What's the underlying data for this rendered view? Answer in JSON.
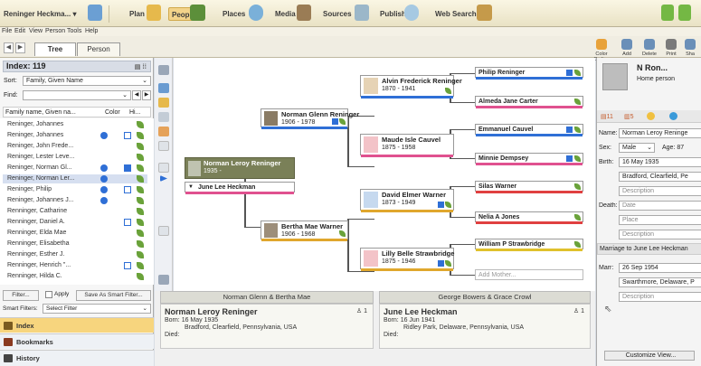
{
  "toolbar": {
    "file_name": "Reninger Heckma... ▾",
    "items": [
      "Plan",
      "People",
      "Places",
      "Media",
      "Sources",
      "Publish",
      "Web Search"
    ],
    "colors": {
      "people_active": "#f3d38a",
      "accent_green": "#6aa23a"
    }
  },
  "menu": [
    "File",
    "Edit",
    "View",
    "Person",
    "Tools",
    "Help"
  ],
  "views": {
    "tabs": [
      "Tree",
      "Person"
    ],
    "active": "Tree"
  },
  "tools": [
    "Color Coding",
    "Add",
    "Delete",
    "Print",
    "Sha"
  ],
  "index": {
    "title": "Index: 119",
    "sort_label": "Sort:",
    "sort_value": "Family, Given Name",
    "find_label": "Find:",
    "columns": [
      "Family name, Given na...",
      "Color",
      "Hi..."
    ],
    "rows": [
      {
        "name": "Reninger, Johannes",
        "dot": false,
        "sq": "none"
      },
      {
        "name": "Reninger, Johannes",
        "dot": true,
        "sq": "empty"
      },
      {
        "name": "Reninger, John Frede...",
        "dot": false,
        "sq": "none"
      },
      {
        "name": "Reninger, Lester Leve...",
        "dot": false,
        "sq": "none"
      },
      {
        "name": "Reninger, Norman Gl...",
        "dot": true,
        "sq": "filled"
      },
      {
        "name": "Reninger, Norman Ler...",
        "dot": true,
        "sq": "none",
        "selected": true
      },
      {
        "name": "Reninger, Philip",
        "dot": true,
        "sq": "empty"
      },
      {
        "name": "Reninger, Johannes J...",
        "dot": true,
        "sq": "none"
      },
      {
        "name": "Renninger, Catharine",
        "dot": false,
        "sq": "none"
      },
      {
        "name": "Renninger, Daniel A.",
        "dot": false,
        "sq": "empty"
      },
      {
        "name": "Renninger, Elda Mae",
        "dot": false,
        "sq": "none"
      },
      {
        "name": "Renninger, Elisabetha",
        "dot": false,
        "sq": "none"
      },
      {
        "name": "Renninger, Esther J.",
        "dot": false,
        "sq": "none"
      },
      {
        "name": "Renninger, Henrich \"...",
        "dot": false,
        "sq": "empty"
      },
      {
        "name": "Renninger, Hilda C.",
        "dot": false,
        "sq": "none"
      }
    ],
    "filter_btn": "Filter...",
    "apply_label": "Apply",
    "save_smart_btn": "Save As Smart Filter...",
    "smart_filters_label": "Smart Filters:",
    "smart_filters_value": "Select Filter"
  },
  "left_nav": [
    "Index",
    "Bookmarks",
    "History"
  ],
  "tree": {
    "root": {
      "name": "Norman Leroy Reninger",
      "years": "1935 -"
    },
    "spouse": "June Lee Heckman",
    "father": {
      "name": "Norman Glenn Reninger",
      "years": "1906 - 1978"
    },
    "mother": {
      "name": "Bertha Mae Warner",
      "years": "1906 - 1968"
    },
    "ff": {
      "name": "Alvin Frederick Reninger",
      "years": "1870 - 1941"
    },
    "fm": {
      "name": "Maude Isle Cauvel",
      "years": "1875 - 1958"
    },
    "mf": {
      "name": "David Elmer Warner",
      "years": "1873 - 1949"
    },
    "mm": {
      "name": "Lilly Belle Strawbridge",
      "years": "1875 - 1946"
    },
    "gg": [
      "Philip Reninger",
      "Almeda Jane Carter",
      "Emmanuel Cauvel",
      "Minnie Dempsey",
      "Silas Warner",
      "Nelia A Jones",
      "William P Strawbridge",
      "Add Mother..."
    ]
  },
  "families": [
    {
      "header": "Norman Glenn & Bertha Mae",
      "name": "Norman Leroy Reninger",
      "count": "1",
      "born_label": "Born:",
      "born_date": "16 May 1935",
      "born_place": "Bradford, Clearfield, Pennsylvania, USA",
      "died_label": "Died:"
    },
    {
      "header": "George Bowers & Grace Crowl",
      "name": "June Lee Heckman",
      "count": "1",
      "born_label": "Born:",
      "born_date": "16 Jun 1941",
      "born_place": "Ridley Park, Delaware, Pennsylvania, USA",
      "died_label": "Died:"
    }
  ],
  "person": {
    "title": "N Ron...",
    "subtitle": "Home person",
    "tab_count": "11",
    "tab_count2": "5",
    "name_label": "Name:",
    "name_value": "Norman Leroy Reninge",
    "sex_label": "Sex:",
    "sex_value": "Male",
    "age_label": "Age: 87",
    "birth_label": "Birth:",
    "birth_date": "16 May 1935",
    "birth_place": "Bradford, Clearfield, Pe",
    "description_ph": "Description",
    "death_label": "Death:",
    "date_ph": "Date",
    "place_ph": "Place",
    "marriage_header": "Marriage to June Lee Heckman",
    "marr_label": "Marr:",
    "marr_date": "26 Sep 1954",
    "marr_place": "Swarthmore, Delaware, P",
    "customize_btn": "Customize View..."
  }
}
